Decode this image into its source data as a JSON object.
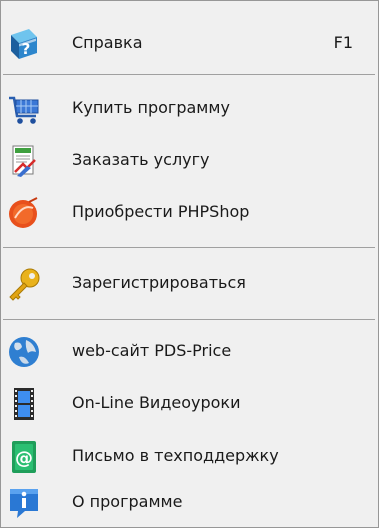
{
  "menu": {
    "items": [
      {
        "label": "Справка",
        "shortcut": "F1",
        "icon": "help-book-icon"
      },
      {
        "label": "Купить программу",
        "icon": "shopping-cart-icon"
      },
      {
        "label": "Заказать услугу",
        "icon": "order-document-icon"
      },
      {
        "label": "Приобрести PHPShop",
        "icon": "phpshop-logo-icon"
      },
      {
        "label": "Зарегистрироваться",
        "icon": "key-icon"
      },
      {
        "label": "web-сайт PDS-Price",
        "icon": "globe-icon"
      },
      {
        "label": "On-Line Видеоуроки",
        "icon": "film-strip-icon"
      },
      {
        "label": "Письмо в техподдержку",
        "icon": "email-at-icon"
      },
      {
        "label": "О программе",
        "icon": "info-icon"
      }
    ]
  },
  "colors": {
    "background": "#f0f0f0",
    "border": "#979797",
    "separator": "#a0a0a0",
    "text": "#1a1a1a"
  }
}
